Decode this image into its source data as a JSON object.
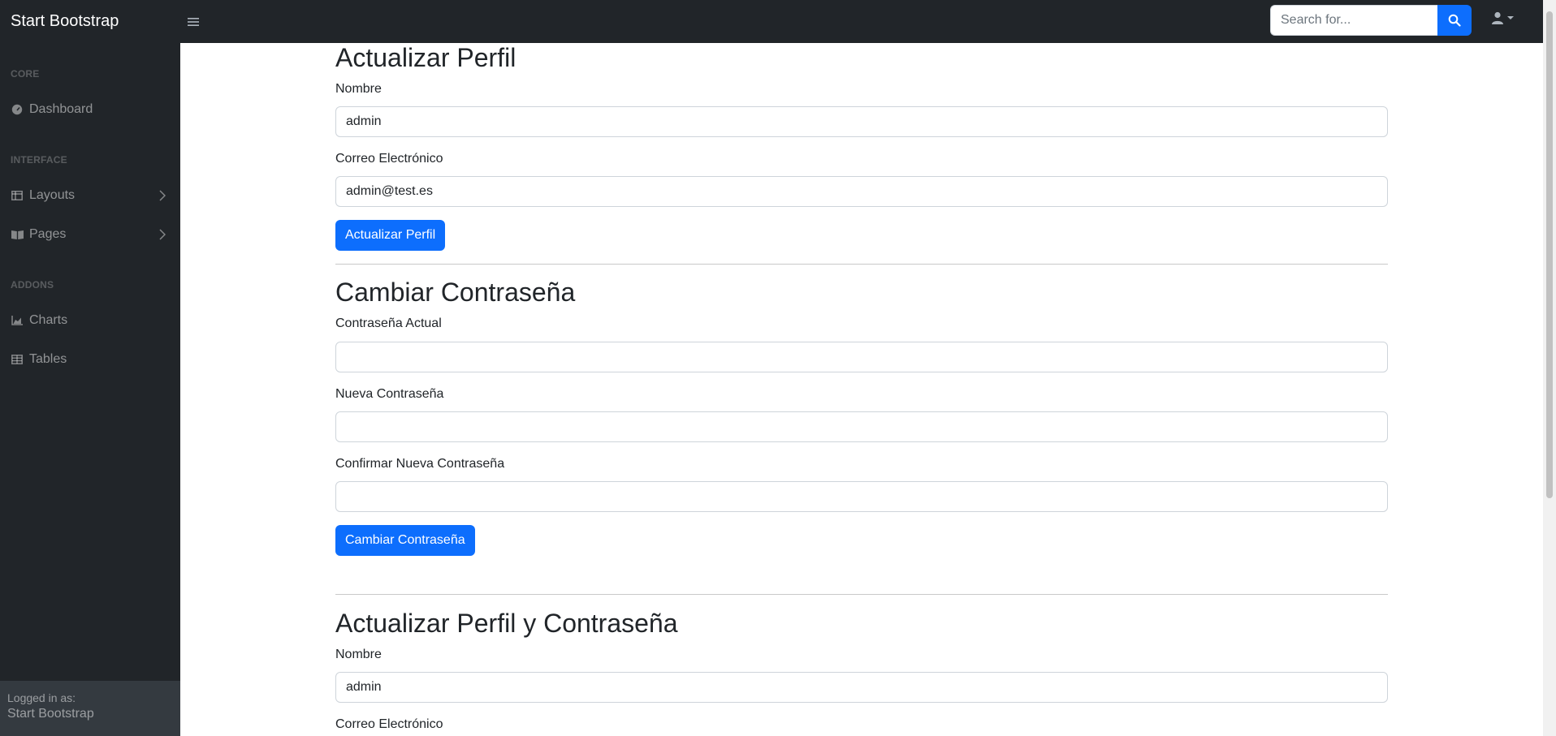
{
  "navbar": {
    "brand": "Start Bootstrap",
    "search_placeholder": "Search for..."
  },
  "sidebar": {
    "headings": {
      "core": "CORE",
      "interface": "INTERFACE",
      "addons": "ADDONS"
    },
    "items": {
      "dashboard": "Dashboard",
      "layouts": "Layouts",
      "pages": "Pages",
      "charts": "Charts",
      "tables": "Tables"
    },
    "footer": {
      "logged_in_label": "Logged in as:",
      "user": "Start Bootstrap"
    }
  },
  "profile": {
    "title": "Actualizar Perfil",
    "name_label": "Nombre",
    "name_value": "admin",
    "email_label": "Correo Electrónico",
    "email_value": "admin@test.es",
    "submit": "Actualizar Perfil"
  },
  "password": {
    "title": "Cambiar Contraseña",
    "current_label": "Contraseña Actual",
    "new_label": "Nueva Contraseña",
    "confirm_label": "Confirmar Nueva Contraseña",
    "submit": "Cambiar Contraseña"
  },
  "combined": {
    "title": "Actualizar Perfil y Contraseña",
    "name_label": "Nombre",
    "name_value": "admin",
    "email_label": "Correo Electrónico"
  },
  "colors": {
    "primary": "#0d6efd",
    "dark": "#212529",
    "footer": "#343a40"
  }
}
